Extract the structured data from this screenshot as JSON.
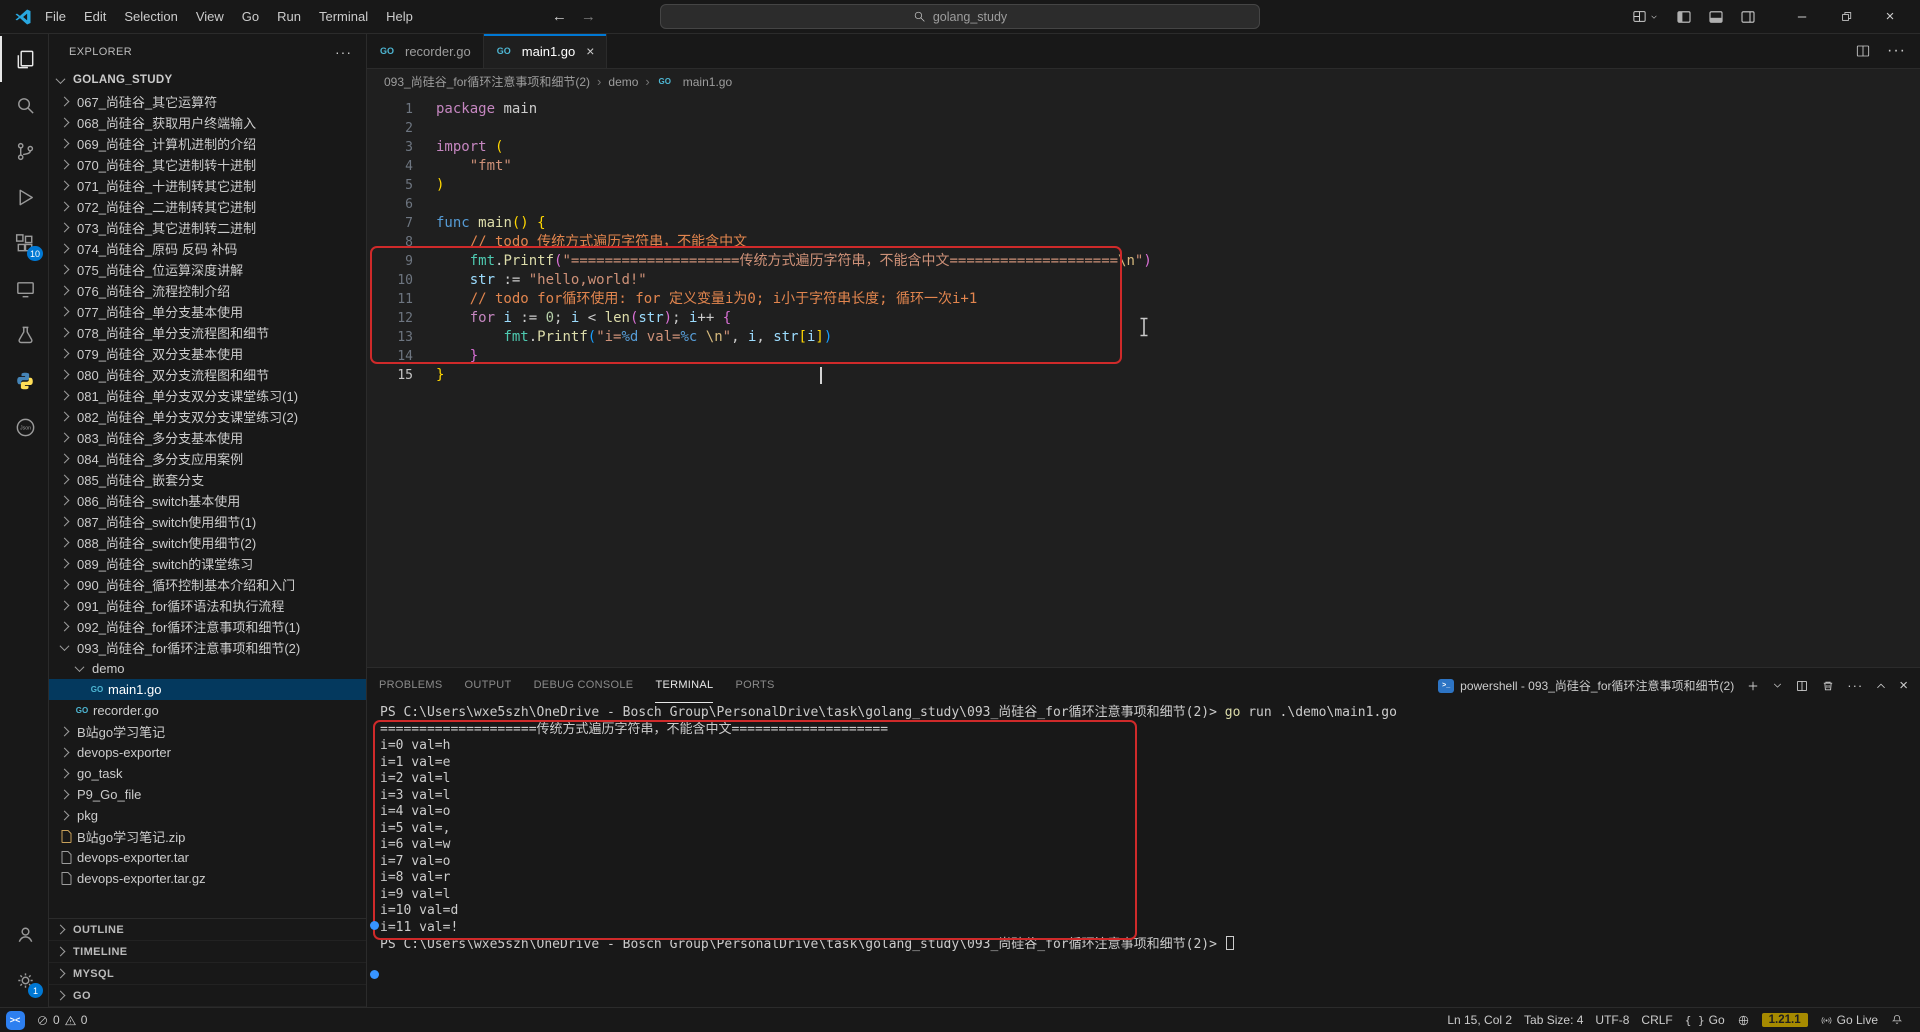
{
  "colors": {
    "accent": "#0078d4",
    "annotation_red": "#cf2a2a",
    "selection_bg": "#04395e",
    "go_badge_bg": "#a68a00"
  },
  "titlebar": {
    "menus": [
      "File",
      "Edit",
      "Selection",
      "View",
      "Go",
      "Run",
      "Terminal",
      "Help"
    ],
    "search": {
      "value": "golang_study"
    }
  },
  "activity_bar": {
    "extensions_badge": "10",
    "settings_badge": "1"
  },
  "explorer": {
    "title": "EXPLORER",
    "more": "···",
    "root": "GOLANG_STUDY",
    "items": [
      {
        "label": "067_尚硅谷_其它运算符",
        "type": "folder",
        "level": 0
      },
      {
        "label": "068_尚硅谷_获取用户终端输入",
        "type": "folder",
        "level": 0
      },
      {
        "label": "069_尚硅谷_计算机进制的介绍",
        "type": "folder",
        "level": 0
      },
      {
        "label": "070_尚硅谷_其它进制转十进制",
        "type": "folder",
        "level": 0
      },
      {
        "label": "071_尚硅谷_十进制转其它进制",
        "type": "folder",
        "level": 0
      },
      {
        "label": "072_尚硅谷_二进制转其它进制",
        "type": "folder",
        "level": 0
      },
      {
        "label": "073_尚硅谷_其它进制转二进制",
        "type": "folder",
        "level": 0
      },
      {
        "label": "074_尚硅谷_原码 反码 补码",
        "type": "folder",
        "level": 0
      },
      {
        "label": "075_尚硅谷_位运算深度讲解",
        "type": "folder",
        "level": 0
      },
      {
        "label": "076_尚硅谷_流程控制介绍",
        "type": "folder",
        "level": 0
      },
      {
        "label": "077_尚硅谷_单分支基本使用",
        "type": "folder",
        "level": 0
      },
      {
        "label": "078_尚硅谷_单分支流程图和细节",
        "type": "folder",
        "level": 0
      },
      {
        "label": "079_尚硅谷_双分支基本使用",
        "type": "folder",
        "level": 0
      },
      {
        "label": "080_尚硅谷_双分支流程图和细节",
        "type": "folder",
        "level": 0
      },
      {
        "label": "081_尚硅谷_单分支双分支课堂练习(1)",
        "type": "folder",
        "level": 0
      },
      {
        "label": "082_尚硅谷_单分支双分支课堂练习(2)",
        "type": "folder",
        "level": 0
      },
      {
        "label": "083_尚硅谷_多分支基本使用",
        "type": "folder",
        "level": 0
      },
      {
        "label": "084_尚硅谷_多分支应用案例",
        "type": "folder",
        "level": 0
      },
      {
        "label": "085_尚硅谷_嵌套分支",
        "type": "folder",
        "level": 0
      },
      {
        "label": "086_尚硅谷_switch基本使用",
        "type": "folder",
        "level": 0
      },
      {
        "label": "087_尚硅谷_switch使用细节(1)",
        "type": "folder",
        "level": 0
      },
      {
        "label": "088_尚硅谷_switch使用细节(2)",
        "type": "folder",
        "level": 0
      },
      {
        "label": "089_尚硅谷_switch的课堂练习",
        "type": "folder",
        "level": 0
      },
      {
        "label": "090_尚硅谷_循环控制基本介绍和入门",
        "type": "folder",
        "level": 0
      },
      {
        "label": "091_尚硅谷_for循环语法和执行流程",
        "type": "folder",
        "level": 0
      },
      {
        "label": "092_尚硅谷_for循环注意事项和细节(1)",
        "type": "folder",
        "level": 0
      },
      {
        "label": "093_尚硅谷_for循环注意事项和细节(2)",
        "type": "folder",
        "level": 0,
        "expanded": true
      },
      {
        "label": "demo",
        "type": "folder",
        "level": 1,
        "expanded": true
      },
      {
        "label": "main1.go",
        "type": "file",
        "level": 2,
        "icon": "go",
        "selected": true
      },
      {
        "label": "recorder.go",
        "type": "file",
        "level": 1,
        "icon": "go"
      },
      {
        "label": "B站go学习笔记",
        "type": "folder",
        "level": 0
      },
      {
        "label": "devops-exporter",
        "type": "folder",
        "level": 0
      },
      {
        "label": "go_task",
        "type": "folder",
        "level": 0
      },
      {
        "label": "P9_Go_file",
        "type": "folder",
        "level": 0
      },
      {
        "label": "pkg",
        "type": "folder",
        "level": 0
      },
      {
        "label": "B站go学习笔记.zip",
        "type": "file",
        "level": 0,
        "icon": "zip"
      },
      {
        "label": "devops-exporter.tar",
        "type": "file",
        "level": 0,
        "icon": "file"
      },
      {
        "label": "devops-exporter.tar.gz",
        "type": "file",
        "level": 0,
        "icon": "file"
      }
    ],
    "sections": [
      "OUTLINE",
      "TIMELINE",
      "MYSQL",
      "GO"
    ]
  },
  "editor": {
    "tabs": [
      {
        "label": "recorder.go"
      },
      {
        "label": "main1.go"
      }
    ],
    "breadcrumb": [
      "093_尚硅谷_for循环注意事项和细节(2)",
      "demo",
      "main1.go"
    ],
    "active_line": 15,
    "code_lines": [
      {
        "tokens": [
          {
            "t": "package",
            "c": "kw"
          },
          {
            "t": " main",
            "c": "pl"
          }
        ]
      },
      {
        "tokens": []
      },
      {
        "tokens": [
          {
            "t": "import",
            "c": "kw"
          },
          {
            "t": " ",
            "c": "pl"
          },
          {
            "t": "(",
            "c": "b1"
          }
        ]
      },
      {
        "tokens": [
          {
            "t": "    ",
            "c": "pl"
          },
          {
            "t": "\"fmt\"",
            "c": "st"
          }
        ]
      },
      {
        "tokens": [
          {
            "t": ")",
            "c": "b1"
          }
        ]
      },
      {
        "tokens": []
      },
      {
        "tokens": [
          {
            "t": "func",
            "c": "kwb"
          },
          {
            "t": " ",
            "c": "pl"
          },
          {
            "t": "main",
            "c": "fn"
          },
          {
            "t": "()",
            "c": "b1"
          },
          {
            "t": " ",
            "c": "pl"
          },
          {
            "t": "{",
            "c": "b1"
          }
        ]
      },
      {
        "tokens": [
          {
            "t": "    ",
            "c": "pl"
          },
          {
            "t": "// todo 传统方式遍历字符串，不能含中文",
            "c": "cm"
          }
        ]
      },
      {
        "tokens": [
          {
            "t": "    ",
            "c": "pl"
          },
          {
            "t": "fmt",
            "c": "ns"
          },
          {
            "t": ".",
            "c": "pl"
          },
          {
            "t": "Printf",
            "c": "fn"
          },
          {
            "t": "(",
            "c": "b2"
          },
          {
            "t": "\"====================传统方式遍历字符串，不能含中文====================",
            "c": "st"
          },
          {
            "t": "\\n",
            "c": "esc"
          },
          {
            "t": "\"",
            "c": "st"
          },
          {
            "t": ")",
            "c": "b2"
          }
        ]
      },
      {
        "tokens": [
          {
            "t": "    ",
            "c": "pl"
          },
          {
            "t": "str",
            "c": "vr"
          },
          {
            "t": " := ",
            "c": "pl"
          },
          {
            "t": "\"hello,world!\"",
            "c": "st"
          }
        ]
      },
      {
        "tokens": [
          {
            "t": "    ",
            "c": "pl"
          },
          {
            "t": "// todo for循环使用: for 定义变量i为0; i小于字符串长度; 循环一次i+1",
            "c": "cm"
          }
        ]
      },
      {
        "tokens": [
          {
            "t": "    ",
            "c": "pl"
          },
          {
            "t": "for",
            "c": "kw"
          },
          {
            "t": " ",
            "c": "pl"
          },
          {
            "t": "i",
            "c": "vr"
          },
          {
            "t": " := ",
            "c": "pl"
          },
          {
            "t": "0",
            "c": "nm"
          },
          {
            "t": "; ",
            "c": "pl"
          },
          {
            "t": "i",
            "c": "vr"
          },
          {
            "t": " < ",
            "c": "pl"
          },
          {
            "t": "len",
            "c": "fn"
          },
          {
            "t": "(",
            "c": "b2"
          },
          {
            "t": "str",
            "c": "vr"
          },
          {
            "t": ")",
            "c": "b2"
          },
          {
            "t": "; ",
            "c": "pl"
          },
          {
            "t": "i",
            "c": "vr"
          },
          {
            "t": "++ ",
            "c": "pl"
          },
          {
            "t": "{",
            "c": "b2"
          }
        ]
      },
      {
        "tokens": [
          {
            "t": "        ",
            "c": "pl"
          },
          {
            "t": "fmt",
            "c": "ns"
          },
          {
            "t": ".",
            "c": "pl"
          },
          {
            "t": "Printf",
            "c": "fn"
          },
          {
            "t": "(",
            "c": "b3"
          },
          {
            "t": "\"i=",
            "c": "st"
          },
          {
            "t": "%d",
            "c": "fs"
          },
          {
            "t": " val=",
            "c": "st"
          },
          {
            "t": "%c",
            "c": "fs"
          },
          {
            "t": " ",
            "c": "st"
          },
          {
            "t": "\\n",
            "c": "esc"
          },
          {
            "t": "\"",
            "c": "st"
          },
          {
            "t": ", ",
            "c": "pl"
          },
          {
            "t": "i",
            "c": "vr"
          },
          {
            "t": ", ",
            "c": "pl"
          },
          {
            "t": "str",
            "c": "vr"
          },
          {
            "t": "[",
            "c": "b1"
          },
          {
            "t": "i",
            "c": "vr"
          },
          {
            "t": "]",
            "c": "b1"
          },
          {
            "t": ")",
            "c": "b3"
          }
        ]
      },
      {
        "tokens": [
          {
            "t": "    ",
            "c": "pl"
          },
          {
            "t": "}",
            "c": "b2"
          }
        ]
      },
      {
        "tokens": [
          {
            "t": "}",
            "c": "b1"
          }
        ]
      }
    ]
  },
  "panel": {
    "tabs": [
      "PROBLEMS",
      "OUTPUT",
      "DEBUG CONSOLE",
      "TERMINAL",
      "PORTS"
    ],
    "active_tab": "TERMINAL",
    "session": "powershell - 093_尚硅谷_for循环注意事项和细节(2)",
    "terminal_lines": [
      {
        "segments": [
          {
            "t": "PS C:\\Users\\wxe5szh\\OneDrive - Bosch Group\\PersonalDrive\\task\\golang_study\\093_尚硅谷_for循环注意事项和细节(2)> ",
            "c": "pl"
          },
          {
            "t": "go",
            "c": "cmd"
          },
          {
            "t": " run .\\demo\\main1.go",
            "c": "pl"
          }
        ]
      },
      {
        "segments": [
          {
            "t": "====================传统方式遍历字符串，不能含中文====================",
            "c": "pl"
          }
        ]
      },
      {
        "segments": [
          {
            "t": "i=0 val=h",
            "c": "pl"
          }
        ]
      },
      {
        "segments": [
          {
            "t": "i=1 val=e",
            "c": "pl"
          }
        ]
      },
      {
        "segments": [
          {
            "t": "i=2 val=l",
            "c": "pl"
          }
        ]
      },
      {
        "segments": [
          {
            "t": "i=3 val=l",
            "c": "pl"
          }
        ]
      },
      {
        "segments": [
          {
            "t": "i=4 val=o",
            "c": "pl"
          }
        ]
      },
      {
        "segments": [
          {
            "t": "i=5 val=,",
            "c": "pl"
          }
        ]
      },
      {
        "segments": [
          {
            "t": "i=6 val=w",
            "c": "pl"
          }
        ]
      },
      {
        "segments": [
          {
            "t": "i=7 val=o",
            "c": "pl"
          }
        ]
      },
      {
        "segments": [
          {
            "t": "i=8 val=r",
            "c": "pl"
          }
        ]
      },
      {
        "segments": [
          {
            "t": "i=9 val=l",
            "c": "pl"
          }
        ]
      },
      {
        "segments": [
          {
            "t": "i=10 val=d",
            "c": "pl"
          }
        ]
      },
      {
        "segments": [
          {
            "t": "i=11 val=!",
            "c": "pl"
          }
        ]
      },
      {
        "segments": [
          {
            "t": "PS C:\\Users\\wxe5szh\\OneDrive - Bosch Group\\PersonalDrive\\task\\golang_study\\093_尚硅谷_for循环注意事项和细节(2)> ",
            "c": "pl"
          }
        ],
        "cursor": true
      }
    ]
  },
  "status_bar": {
    "errors": "0",
    "warnings": "0",
    "line_col": "Ln 15, Col 2",
    "tab_size": "Tab Size: 4",
    "encoding": "UTF-8",
    "eol": "CRLF",
    "language": "Go",
    "go_version": "1.21.1",
    "go_live": "Go Live"
  }
}
